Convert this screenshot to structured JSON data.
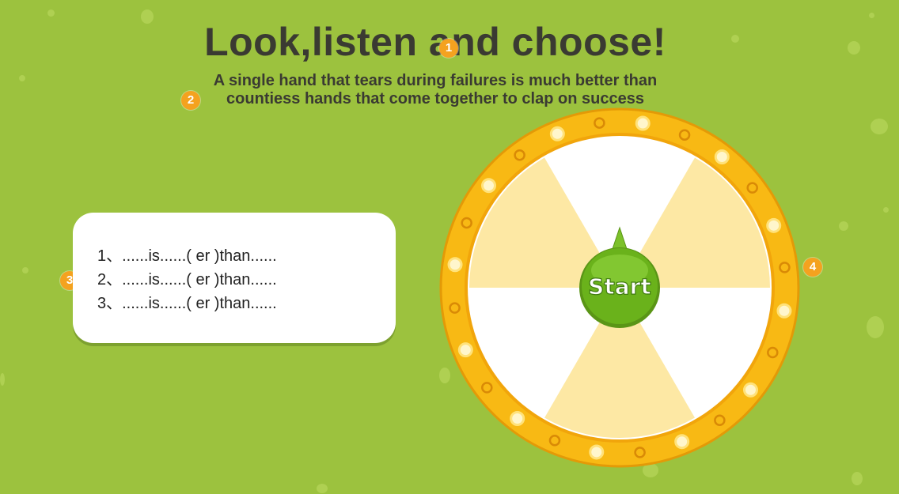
{
  "header": {
    "title": "Look,listen and choose!",
    "subtitle_line1": "A single hand that tears during failures is much better than",
    "subtitle_line2": "countiess hands that come together to clap on success"
  },
  "markers": [
    "1",
    "2",
    "3",
    "4"
  ],
  "sentences": [
    "1、......is......( er )than......",
    "2、......is......( er )than......",
    "3、......is......( er )than......"
  ],
  "wheel": {
    "start_label": "Start",
    "segment_count": 6,
    "colors": {
      "rim": "#f8b914",
      "rim_dark": "#e39a07",
      "segment_light": "#fde8a4",
      "segment_white": "#ffffff",
      "button": "#6ab21b",
      "background": "#9cc23e",
      "marker": "#f4a21f"
    }
  }
}
